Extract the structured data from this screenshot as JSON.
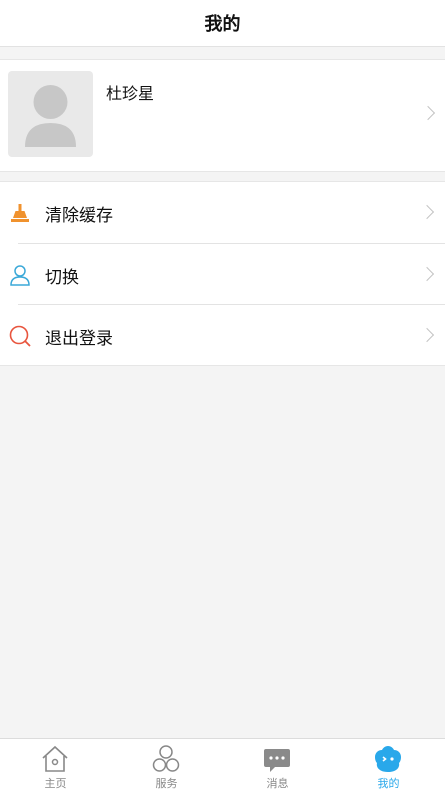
{
  "header": {
    "title": "我的"
  },
  "profile": {
    "name": "杜珍星"
  },
  "menu": {
    "items": [
      {
        "label": "清除缓存",
        "icon": "broom-icon"
      },
      {
        "label": "切换",
        "icon": "user-outline-icon"
      },
      {
        "label": "退出登录",
        "icon": "search-circle-icon"
      }
    ]
  },
  "tabbar": {
    "tabs": [
      {
        "label": "主页",
        "icon": "home-icon",
        "active": false
      },
      {
        "label": "服务",
        "icon": "circles-icon",
        "active": false
      },
      {
        "label": "消息",
        "icon": "chat-bubble-icon",
        "active": false
      },
      {
        "label": "我的",
        "icon": "profile-face-icon",
        "active": true
      }
    ]
  },
  "colors": {
    "accent": "#29a8ea",
    "broom": "#f0922e",
    "user_outline": "#3aa8d8",
    "search_circle": "#e8553e"
  }
}
